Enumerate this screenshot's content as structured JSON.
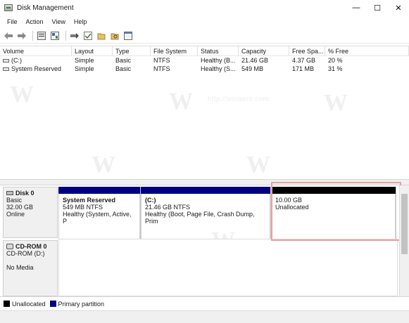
{
  "window": {
    "title": "Disk Management",
    "controls": {
      "minimize": "—",
      "maximize": "☐",
      "close": "✕"
    }
  },
  "menu": [
    "File",
    "Action",
    "View",
    "Help"
  ],
  "toolbar": {
    "icons": [
      "back-icon",
      "forward-icon",
      "properties-icon",
      "help-icon",
      "connect-icon",
      "check-icon",
      "folder-icon",
      "search-icon",
      "console-icon"
    ]
  },
  "volume_table": {
    "headers": [
      "Volume",
      "Layout",
      "Type",
      "File System",
      "Status",
      "Capacity",
      "Free Spa...",
      "% Free"
    ],
    "rows": [
      {
        "volume": "(C:)",
        "layout": "Simple",
        "type": "Basic",
        "fs": "NTFS",
        "status": "Healthy (B...",
        "capacity": "21.46 GB",
        "free": "4.37 GB",
        "pct": "20 %"
      },
      {
        "volume": "System Reserved",
        "layout": "Simple",
        "type": "Basic",
        "fs": "NTFS",
        "status": "Healthy (S...",
        "capacity": "549 MB",
        "free": "171 MB",
        "pct": "31 %"
      }
    ]
  },
  "disks": {
    "disk0": {
      "name": "Disk 0",
      "type": "Basic",
      "size": "32.00 GB",
      "state": "Online",
      "partitions": [
        {
          "name": "System Reserved",
          "size": "549 MB NTFS",
          "status": "Healthy (System, Active, P",
          "bar_color": "#000080"
        },
        {
          "name": "(C:)",
          "size": "21.46 GB NTFS",
          "status": "Healthy (Boot, Page File, Crash Dump, Prim",
          "bar_color": "#000080"
        },
        {
          "name": "",
          "size": "10.00 GB",
          "status": "Unallocated",
          "bar_color": "#000000"
        }
      ]
    },
    "cdrom0": {
      "name": "CD-ROM 0",
      "drive": "CD-ROM (D:)",
      "state": "No Media"
    }
  },
  "legend": [
    {
      "label": "Unallocated",
      "color": "#000000"
    },
    {
      "label": "Primary partition",
      "color": "#000080"
    }
  ],
  "watermark": "http://winaero.com"
}
